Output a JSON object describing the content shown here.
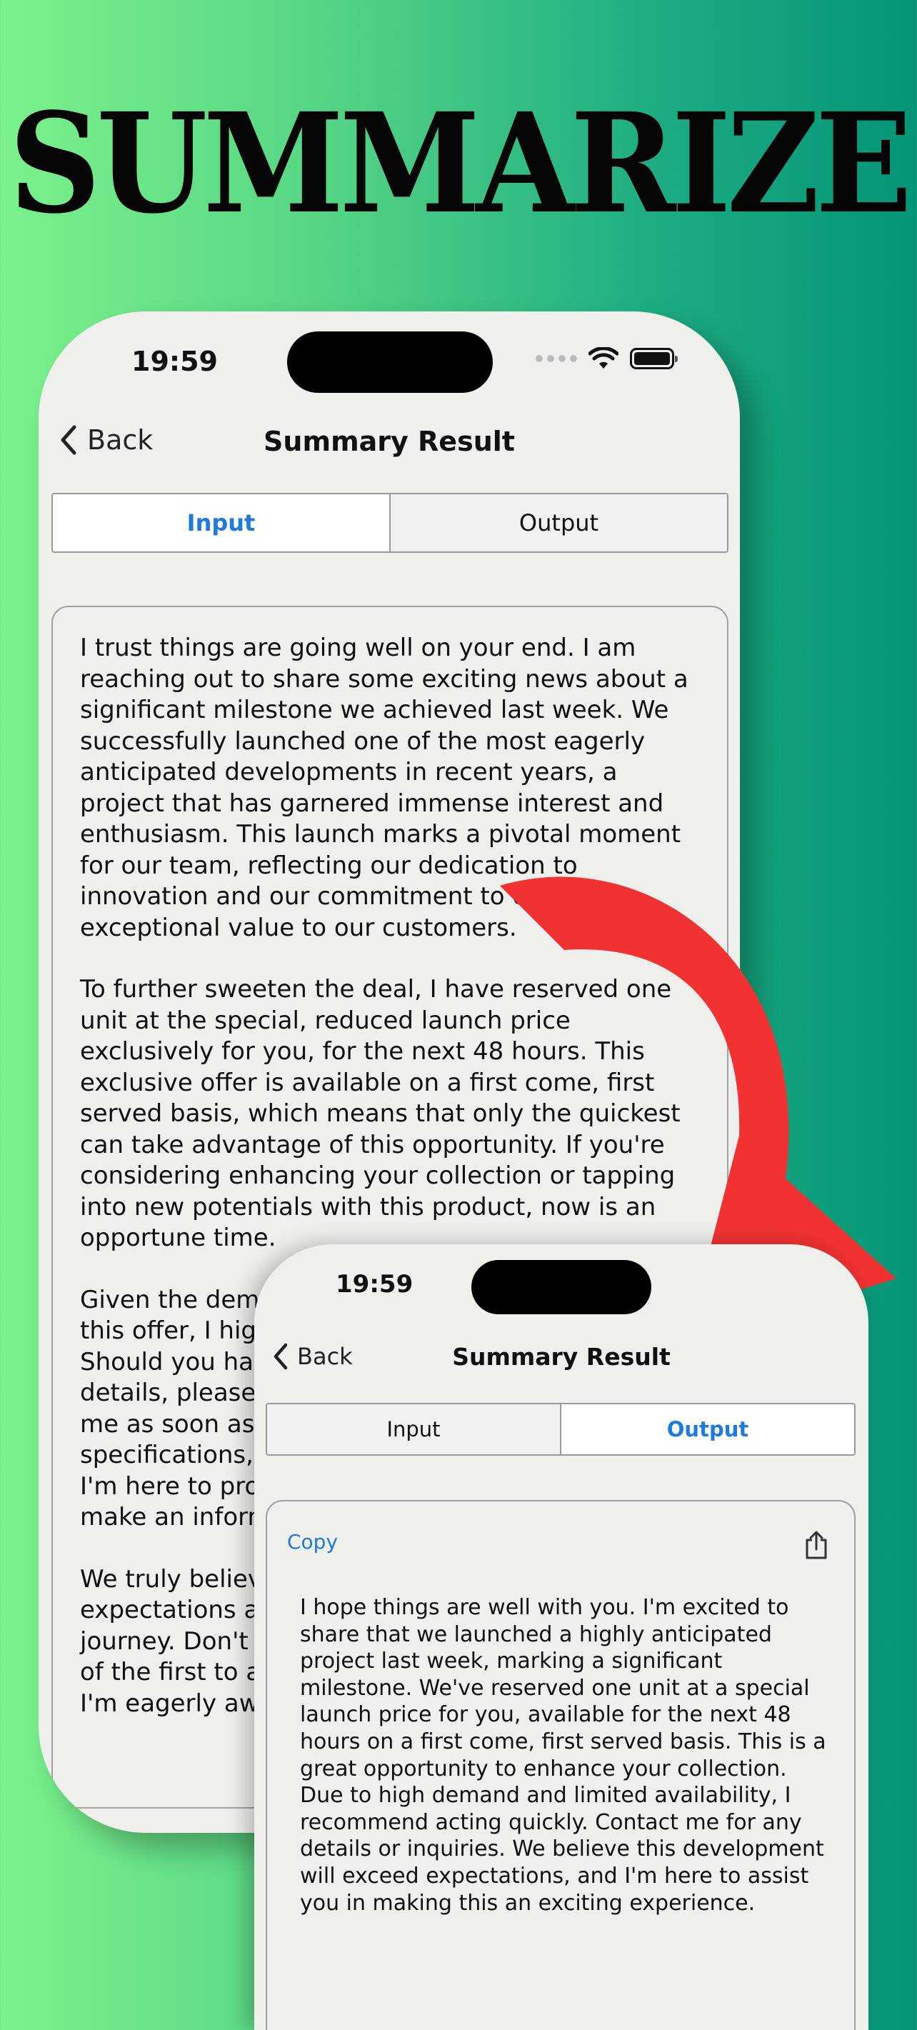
{
  "headline": "SUMMARIZE",
  "colors": {
    "accent": "#1f7ae0",
    "arrow": "#f23232",
    "background_left": "#7cf18c",
    "background_right": "#049577"
  },
  "status_bar": {
    "time": "19:59"
  },
  "input_screen": {
    "back_label": "Back",
    "title": "Summary Result",
    "tabs": [
      {
        "label": "Input",
        "selected": true
      },
      {
        "label": "Output",
        "selected": false
      }
    ],
    "paragraphs": [
      "I trust things are going well on your end. I am reaching out to share some exciting news about a significant milestone we achieved last week. We successfully launched one of the most eagerly anticipated developments in recent years, a project that has garnered immense interest and enthusiasm. This launch marks a pivotal moment for our team, reflecting our dedication to innovation and our commitment to delivering exceptional value to our customers.",
      "To further sweeten the deal, I have reserved one unit at the special, reduced launch price exclusively for you, for the next 48 hours. This exclusive offer is available on a first come, first served basis, which means that only the quickest can take advantage of this opportunity. If you're considering enhancing your collection or tapping into new potentials with this product, now is an opportune time.",
      "Given the dem\nthis offer, I hig\nShould you ha\ndetails, please\nme as soon as\nspecifications,\nI'm here to pro\nmake an inform",
      "We truly believ\nexpectations a\njourney. Don't\nof the first to a\nI'm eagerly aw"
    ]
  },
  "output_screen": {
    "back_label": "Back",
    "title": "Summary Result",
    "tabs": [
      {
        "label": "Input",
        "selected": false
      },
      {
        "label": "Output",
        "selected": true
      }
    ],
    "copy_label": "Copy",
    "share_icon": "share-icon",
    "summary": "I hope things are well with you. I'm excited to share that we launched a highly anticipated project last week, marking a significant milestone. We've reserved one unit at a special launch price for you, available for the next 48 hours on a first come, first served basis. This is a great opportunity to enhance your collection. Due to high demand and limited availability, I recommend acting quickly. Contact me for any details or inquiries. We believe this development will exceed expectations, and I'm here to assist you in making this an exciting experience."
  }
}
